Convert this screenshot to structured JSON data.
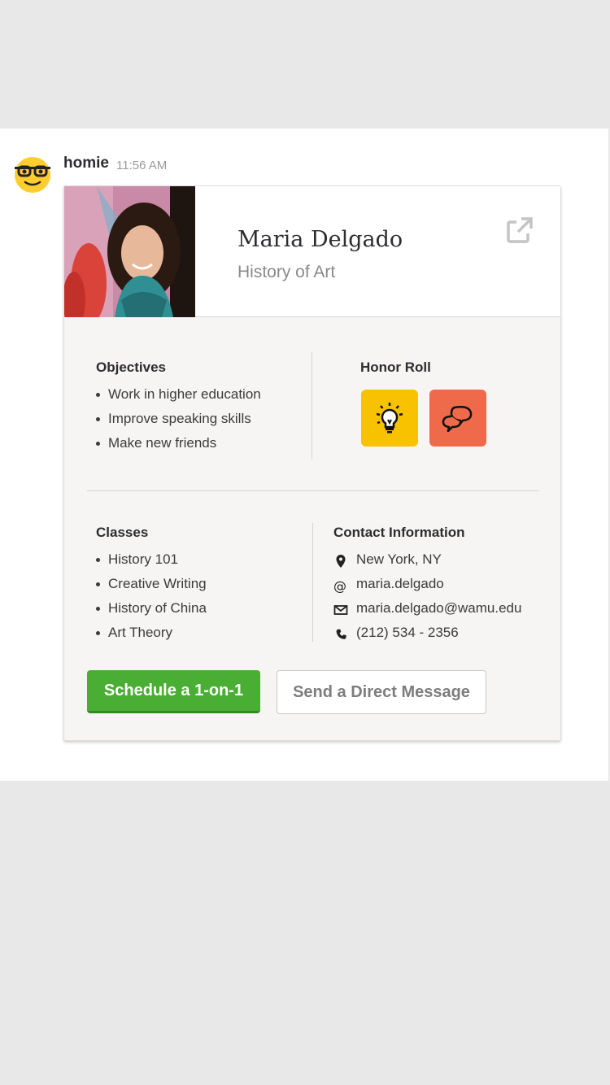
{
  "message": {
    "author": "homie",
    "time": "11:56 AM",
    "avatar_icon": "nerd-face-emoji"
  },
  "profile": {
    "name": "Maria Delgado",
    "department": "History of Art",
    "share_icon": "external-link-icon"
  },
  "objectives": {
    "title": "Objectives",
    "items": [
      "Work in higher education",
      "Improve speaking skills",
      "Make new friends"
    ]
  },
  "honor_roll": {
    "title": "Honor Roll",
    "badges": [
      {
        "icon": "lightbulb-icon",
        "color": "#f8c200"
      },
      {
        "icon": "speech-bubbles-icon",
        "color": "#ef6a4a"
      }
    ]
  },
  "classes": {
    "title": "Classes",
    "items": [
      "History 101",
      "Creative Writing",
      "History of China",
      "Art Theory"
    ]
  },
  "contact": {
    "title": "Contact Information",
    "location": "New York, NY",
    "handle": "maria.delgado",
    "email": "maria.delgado@wamu.edu",
    "phone": "(212) 534 - 2356"
  },
  "actions": {
    "primary": "Schedule a 1-on-1",
    "secondary": "Send a Direct Message"
  },
  "colors": {
    "primary_button": "#4aae35",
    "card_background": "#f6f5f3"
  }
}
